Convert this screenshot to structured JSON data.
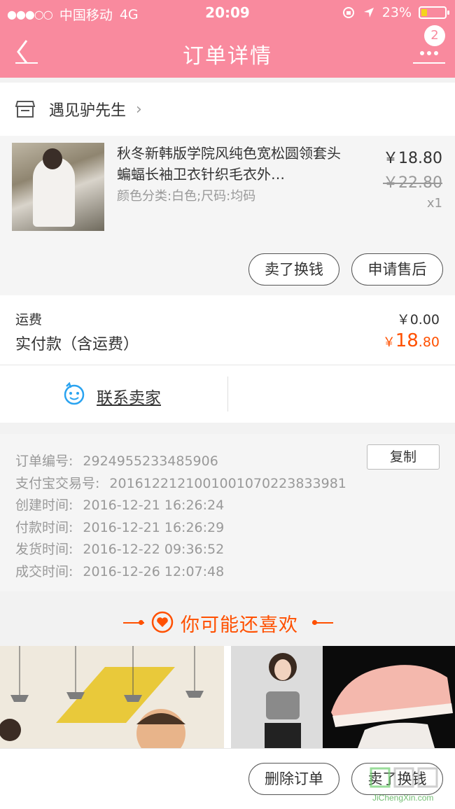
{
  "status_bar": {
    "signal": "●●●○○",
    "carrier": "中国移动",
    "network": "4G",
    "time": "20:09",
    "battery": "23%"
  },
  "nav": {
    "title": "订单详情",
    "badge_count": "2"
  },
  "shop": {
    "name": "遇见驴先生"
  },
  "product": {
    "title": "秋冬新韩版学院风纯色宽松圆领套头蝙蝠长袖卫衣针织毛衣外…",
    "spec": "颜色分类:白色;尺码:均码",
    "price": "￥18.80",
    "original_price": "￥22.80",
    "quantity": "x1",
    "actions": [
      "卖了换钱",
      "申请售后"
    ]
  },
  "fees": {
    "shipping_label": "运费",
    "shipping_value": "￥0.00",
    "paid_label": "实付款（含运费）",
    "paid_currency": "￥",
    "paid_integer": "18",
    "paid_decimal": ".80"
  },
  "contact": {
    "label": "联系卖家"
  },
  "order_info": {
    "copy_label": "复制",
    "rows": [
      {
        "label": "订单编号:",
        "value": "2924955233485906"
      },
      {
        "label": "支付宝交易号:",
        "value": "2016122121001001070223833981"
      },
      {
        "label": "创建时间:",
        "value": "2016-12-21 16:26:24"
      },
      {
        "label": "付款时间:",
        "value": "2016-12-21 16:26:29"
      },
      {
        "label": "发货时间:",
        "value": "2016-12-22 09:36:52"
      },
      {
        "label": "成交时间:",
        "value": "2016-12-26 12:07:48"
      }
    ]
  },
  "recommend": {
    "title": "你可能还喜欢"
  },
  "bottom_bar": {
    "delete_label": "删除订单",
    "sell_label": "卖了换钱"
  },
  "watermark": {
    "text": "JiChengXin.com"
  },
  "colors": {
    "nav_bg": "#f98a9e",
    "accent": "#ff5000",
    "contact_icon": "#2aa3f0"
  }
}
